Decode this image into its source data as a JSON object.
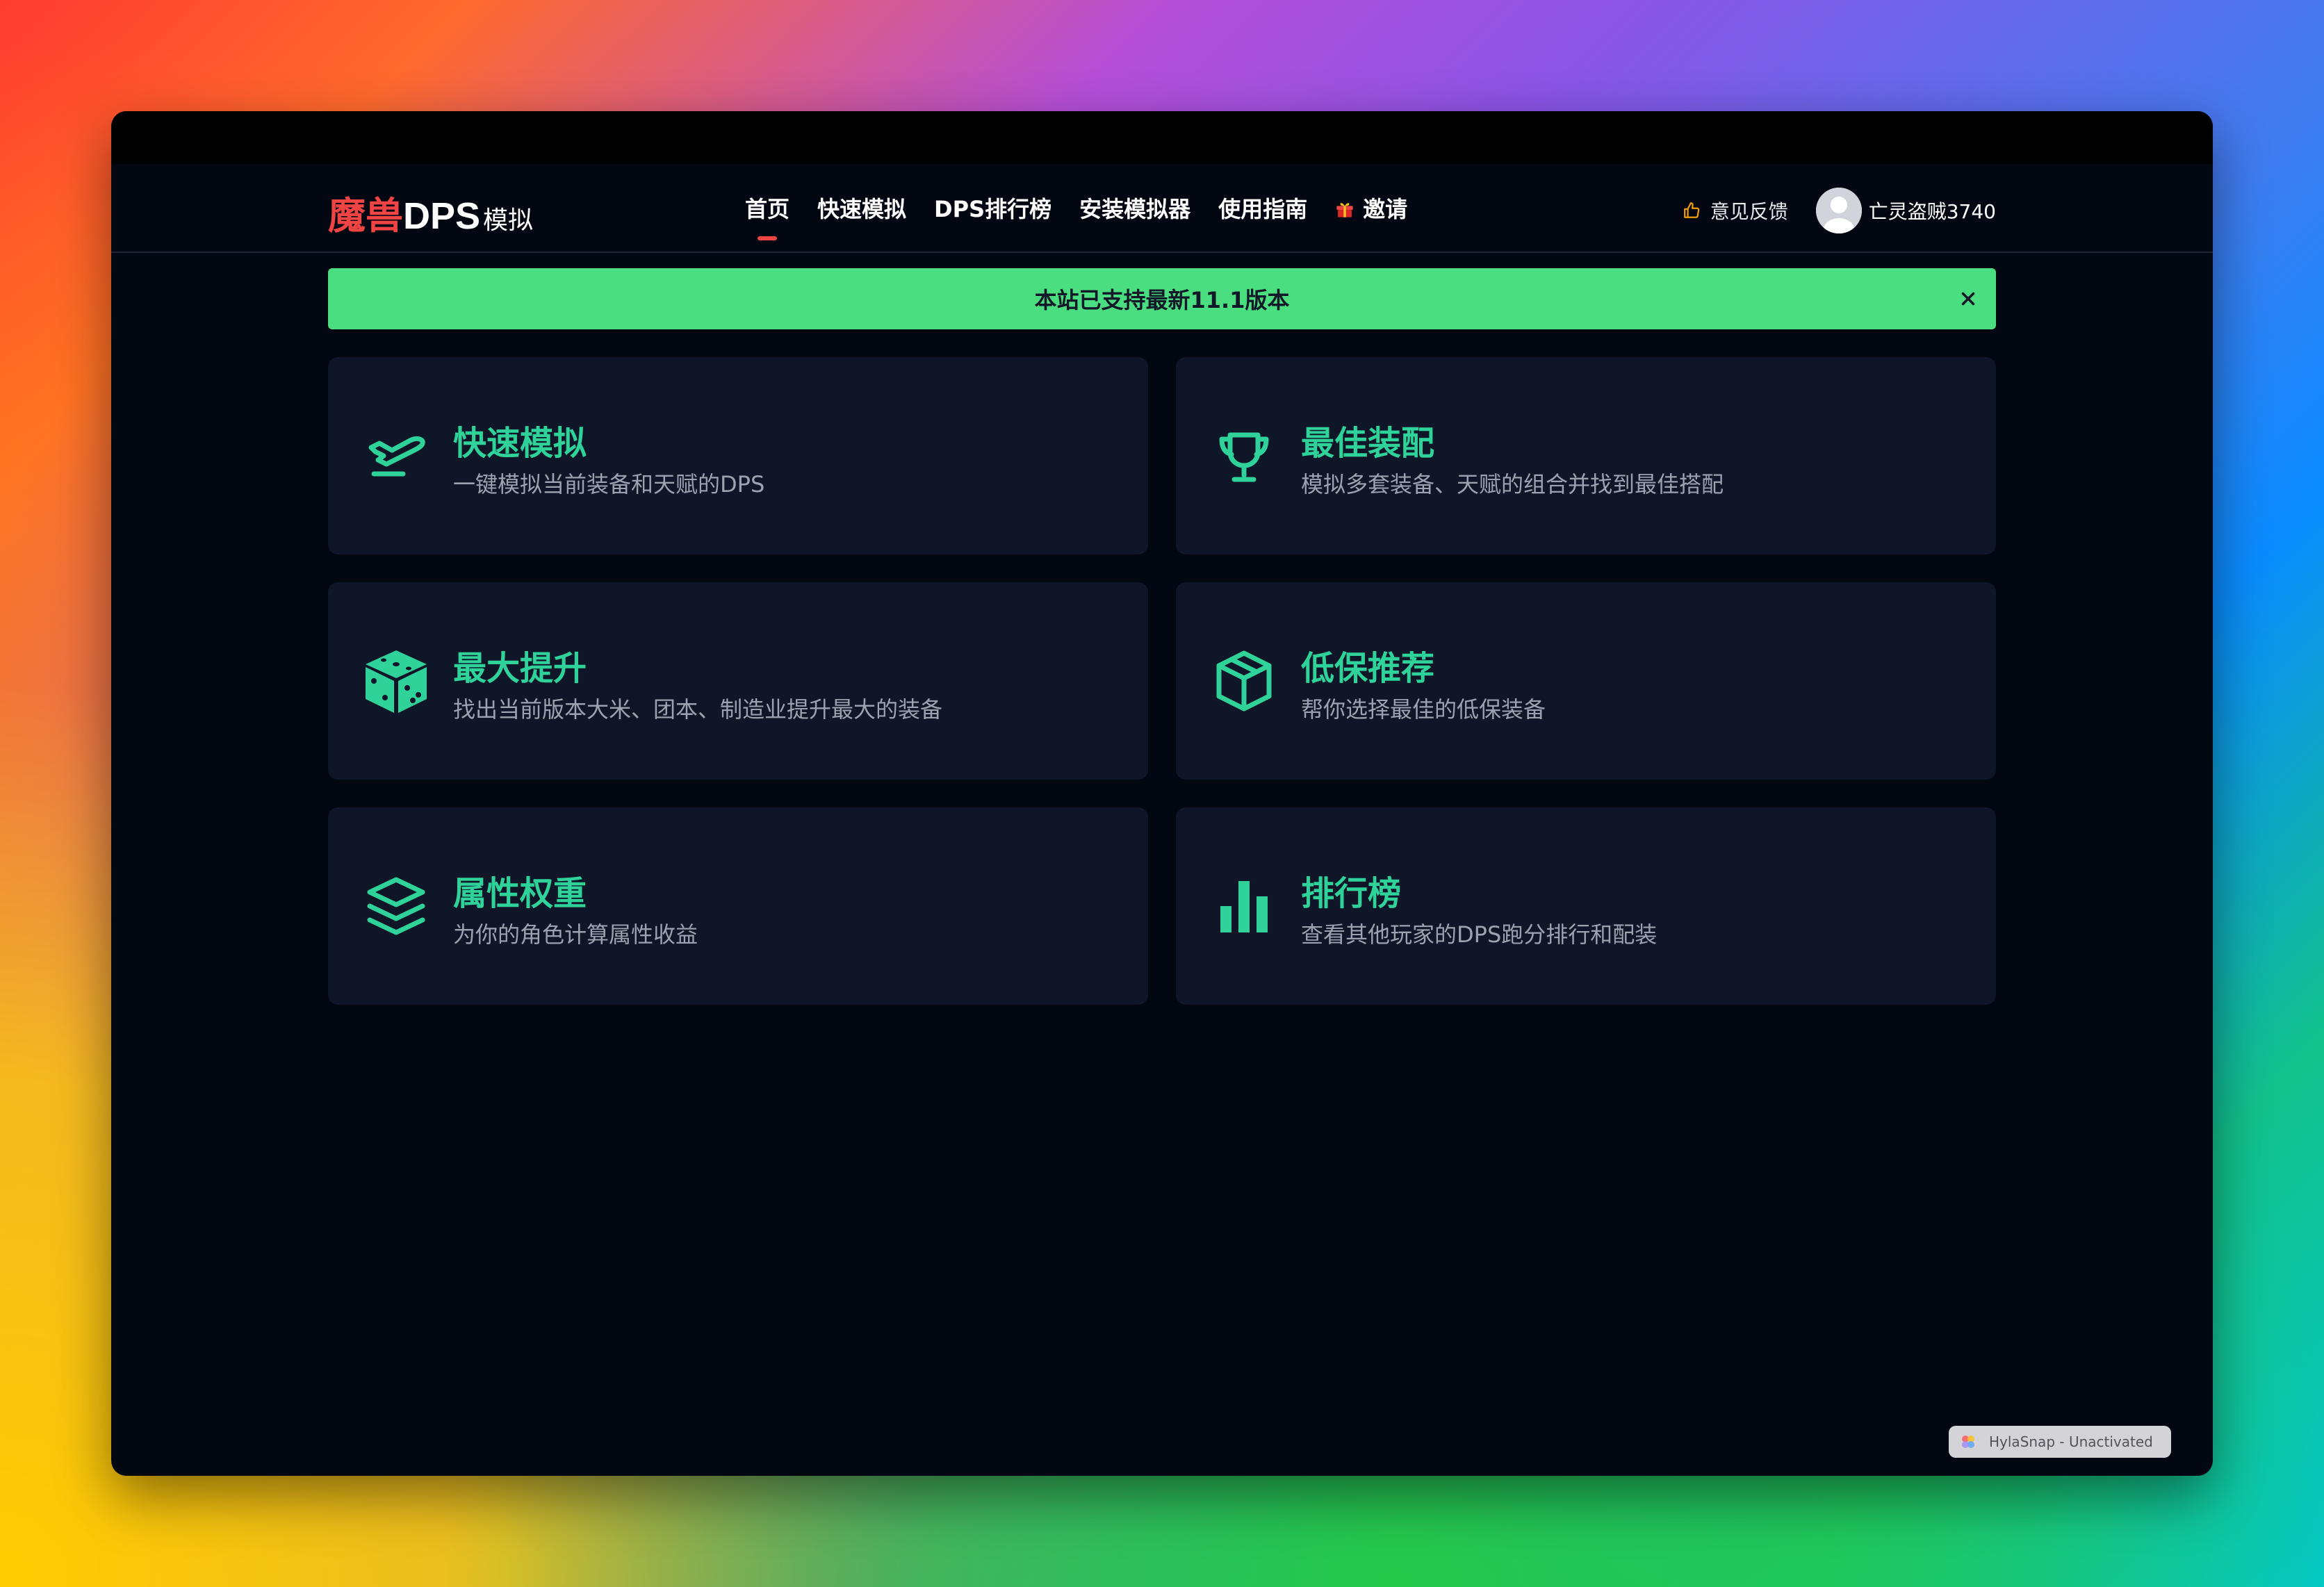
{
  "brand": {
    "part1": "魔兽",
    "part2": "DPS",
    "part3": "模拟"
  },
  "nav": {
    "items": [
      {
        "label": "首页",
        "active": true
      },
      {
        "label": "快速模拟",
        "active": false
      },
      {
        "label": "DPS排行榜",
        "active": false
      },
      {
        "label": "安装模拟器",
        "active": false
      },
      {
        "label": "使用指南",
        "active": false
      },
      {
        "label": "邀请",
        "active": false,
        "icon": "gift-icon"
      }
    ]
  },
  "header": {
    "feedback_label": "意见反馈",
    "feedback_icon": "thumbs-up-icon",
    "username": "亡灵盗贼3740"
  },
  "banner": {
    "text": "本站已支持最新11.1版本",
    "color": "#4ade80"
  },
  "cards": [
    {
      "title": "快速模拟",
      "desc": "一键模拟当前装备和天赋的DPS",
      "icon": "plane-icon"
    },
    {
      "title": "最佳装配",
      "desc": "模拟多套装备、天赋的组合并找到最佳搭配",
      "icon": "trophy-icon"
    },
    {
      "title": "最大提升",
      "desc": "找出当前版本大米、团本、制造业提升最大的装备",
      "icon": "dice-icon"
    },
    {
      "title": "低保推荐",
      "desc": "帮你选择最佳的低保装备",
      "icon": "box-icon"
    },
    {
      "title": "属性权重",
      "desc": "为你的角色计算属性收益",
      "icon": "layers-icon"
    },
    {
      "title": "排行榜",
      "desc": "查看其他玩家的DPS跑分排行和配装",
      "icon": "bar-chart-icon"
    }
  ],
  "colors": {
    "accent": "#2fd39a",
    "brand_red": "#ef4444",
    "card_bg": "#0e1627",
    "page_bg": "#030712"
  },
  "watermark": {
    "text": "HylaSnap - Unactivated"
  }
}
